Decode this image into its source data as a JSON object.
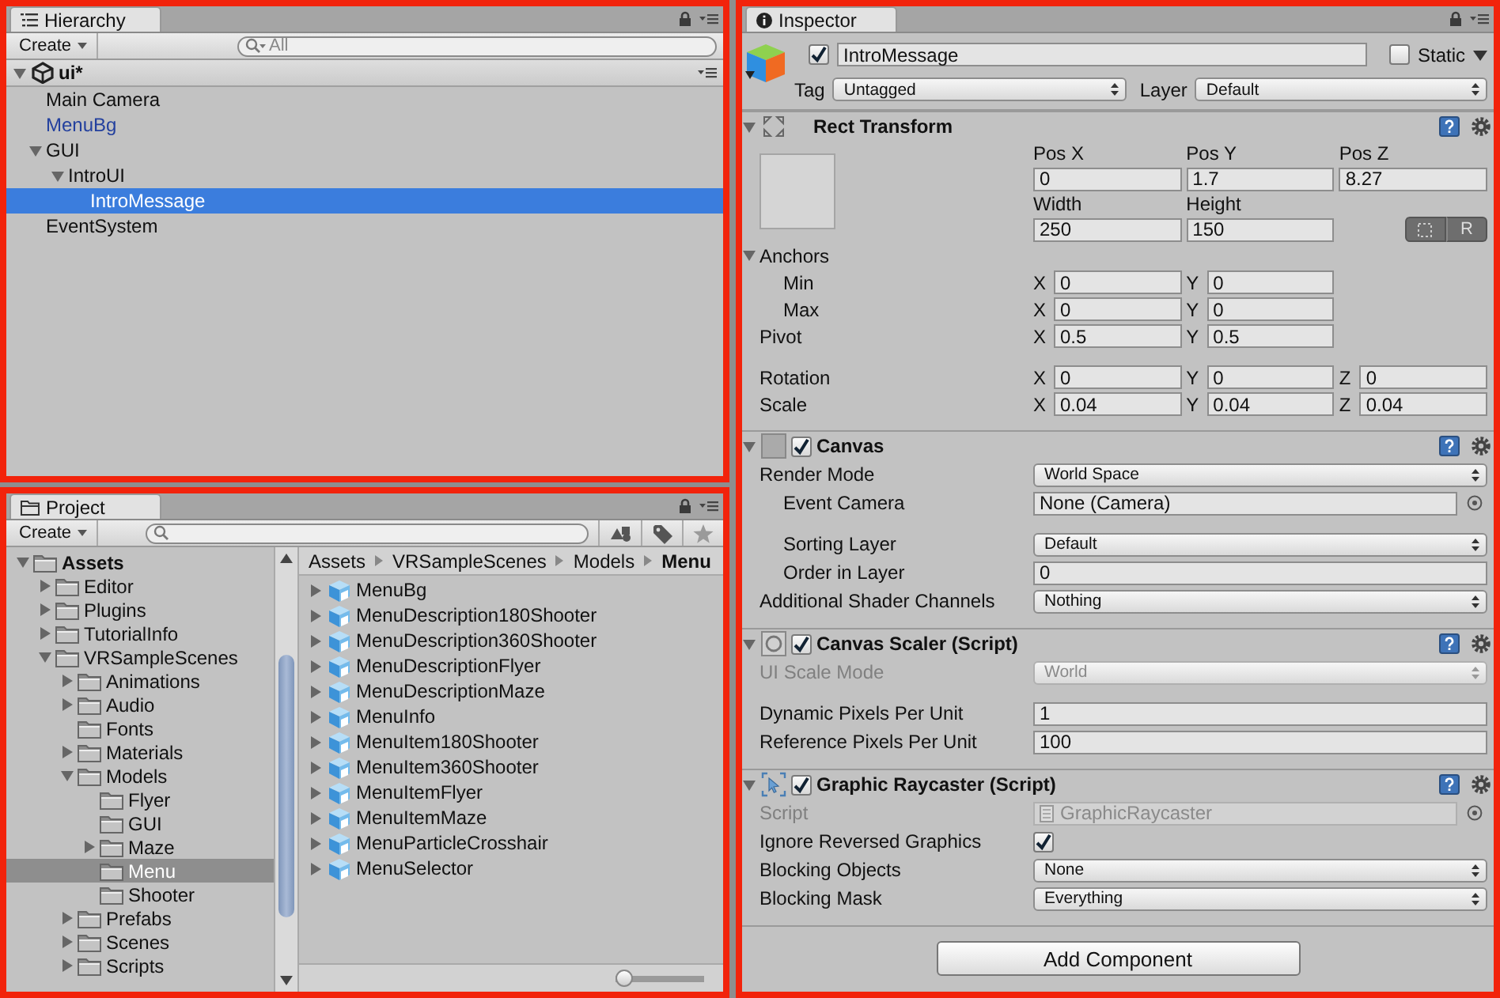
{
  "hierarchy": {
    "tab_title": "Hierarchy",
    "create_button": "Create",
    "search": {
      "placeholder": "All"
    },
    "scene": {
      "name": "ui*",
      "expanded": true
    },
    "items": [
      {
        "label": "Main Camera",
        "kind": "gameobject",
        "selected": false
      },
      {
        "label": "MenuBg",
        "kind": "prefab",
        "selected": false
      },
      {
        "label": "GUI",
        "kind": "gameobject",
        "selected": false,
        "expanded": true,
        "children": [
          {
            "label": "IntroUI",
            "kind": "gameobject",
            "selected": false,
            "expanded": true,
            "children": [
              {
                "label": "IntroMessage",
                "kind": "gameobject",
                "selected": true
              }
            ]
          }
        ]
      },
      {
        "label": "EventSystem",
        "kind": "gameobject",
        "selected": false
      }
    ]
  },
  "project": {
    "tab_title": "Project",
    "create_button": "Create",
    "folders": [
      {
        "label": "Assets",
        "selected": false,
        "expanded": true,
        "children": [
          {
            "label": "Editor",
            "selected": false,
            "expanded": false
          },
          {
            "label": "Plugins",
            "selected": false,
            "expanded": false
          },
          {
            "label": "TutorialInfo",
            "selected": false,
            "expanded": false
          },
          {
            "label": "VRSampleScenes",
            "selected": false,
            "expanded": true,
            "children": [
              {
                "label": "Animations",
                "selected": false,
                "expanded": false
              },
              {
                "label": "Audio",
                "selected": false,
                "expanded": false
              },
              {
                "label": "Fonts",
                "selected": false
              },
              {
                "label": "Materials",
                "selected": false,
                "expanded": false
              },
              {
                "label": "Models",
                "selected": false,
                "expanded": true,
                "children": [
                  {
                    "label": "Flyer",
                    "selected": false
                  },
                  {
                    "label": "GUI",
                    "selected": false
                  },
                  {
                    "label": "Maze",
                    "selected": false,
                    "expanded": false
                  },
                  {
                    "label": "Menu",
                    "selected": true
                  },
                  {
                    "label": "Shooter",
                    "selected": false
                  }
                ]
              },
              {
                "label": "Prefabs",
                "selected": false,
                "expanded": false
              },
              {
                "label": "Scenes",
                "selected": false,
                "expanded": false
              },
              {
                "label": "Scripts",
                "selected": false,
                "expanded": false
              }
            ]
          }
        ]
      }
    ],
    "breadcrumb": [
      {
        "label": "Assets",
        "selected": false
      },
      {
        "label": "VRSampleScenes",
        "selected": false
      },
      {
        "label": "Models",
        "selected": false
      },
      {
        "label": "Menu",
        "selected": true
      }
    ],
    "assets": [
      {
        "label": "MenuBg",
        "expanded": false
      },
      {
        "label": "MenuDescription180Shooter",
        "expanded": false
      },
      {
        "label": "MenuDescription360Shooter",
        "expanded": false
      },
      {
        "label": "MenuDescriptionFlyer",
        "expanded": false
      },
      {
        "label": "MenuDescriptionMaze",
        "expanded": false
      },
      {
        "label": "MenuInfo",
        "expanded": false
      },
      {
        "label": "MenuItem180Shooter",
        "expanded": false
      },
      {
        "label": "MenuItem360Shooter",
        "expanded": false
      },
      {
        "label": "MenuItemFlyer",
        "expanded": false
      },
      {
        "label": "MenuItemMaze",
        "expanded": false
      },
      {
        "label": "MenuParticleCrosshair",
        "expanded": false
      },
      {
        "label": "MenuSelector",
        "expanded": false
      }
    ],
    "zoom_slider": {
      "level": 0
    }
  },
  "inspector": {
    "tab_title": "Inspector",
    "object": {
      "active": true,
      "name": "IntroMessage",
      "static": false,
      "static_label": "Static",
      "tag_label": "Tag",
      "tag": "Untagged",
      "layer_label": "Layer",
      "layer": "Default"
    },
    "rect_transform": {
      "title": "Rect Transform",
      "expanded": true,
      "position": [
        {
          "label": "Pos X",
          "value": "0"
        },
        {
          "label": "Pos Y",
          "value": "1.7"
        },
        {
          "label": "Pos Z",
          "value": "8.27"
        }
      ],
      "size": [
        {
          "label": "Width",
          "value": "250"
        },
        {
          "label": "Height",
          "value": "150"
        }
      ],
      "raw_button": "R",
      "anchors": {
        "label": "Anchors",
        "expanded": true,
        "rows": [
          {
            "label": "Min",
            "fields": [
              {
                "axis": "X",
                "value": "0"
              },
              {
                "axis": "Y",
                "value": "0"
              }
            ]
          },
          {
            "label": "Max",
            "fields": [
              {
                "axis": "X",
                "value": "0"
              },
              {
                "axis": "Y",
                "value": "0"
              }
            ]
          }
        ]
      },
      "rows": [
        {
          "label": "Pivot",
          "fields": [
            {
              "axis": "X",
              "value": "0.5"
            },
            {
              "axis": "Y",
              "value": "0.5"
            }
          ]
        },
        {
          "label": "Rotation",
          "gap_before": true,
          "fields": [
            {
              "axis": "X",
              "value": "0"
            },
            {
              "axis": "Y",
              "value": "0"
            },
            {
              "axis": "Z",
              "value": "0"
            }
          ]
        },
        {
          "label": "Scale",
          "fields": [
            {
              "axis": "X",
              "value": "0.04"
            },
            {
              "axis": "Y",
              "value": "0.04"
            },
            {
              "axis": "Z",
              "value": "0.04"
            }
          ]
        }
      ]
    },
    "components": [
      {
        "title": "Canvas",
        "enabled": true,
        "expanded": true,
        "rows": [
          {
            "label": "Render Mode",
            "kind": "dropdown",
            "value": "World Space",
            "disabled": false,
            "children": [
              {
                "label": "Event Camera",
                "kind": "object",
                "value": "None (Camera)",
                "disabled": false
              },
              {
                "label": "Sorting Layer",
                "kind": "dropdown",
                "value": "Default",
                "disabled": false,
                "gap_before": true
              },
              {
                "label": "Order in Layer",
                "kind": "text",
                "value": "0",
                "disabled": false
              }
            ]
          },
          {
            "label": "Additional Shader Channels",
            "kind": "dropdown",
            "value": "Nothing",
            "disabled": false
          }
        ]
      },
      {
        "title": "Canvas Scaler (Script)",
        "enabled": true,
        "expanded": true,
        "rows": [
          {
            "label": "UI Scale Mode",
            "kind": "dropdown",
            "value": "World",
            "disabled": true
          },
          {
            "label": "Dynamic Pixels Per Unit",
            "kind": "text",
            "value": "1",
            "disabled": false,
            "gap_before": true
          },
          {
            "label": "Reference Pixels Per Unit",
            "kind": "text",
            "value": "100",
            "disabled": false
          }
        ]
      },
      {
        "title": "Graphic Raycaster (Script)",
        "enabled": true,
        "expanded": true,
        "rows": [
          {
            "label": "Script",
            "kind": "script",
            "value": "GraphicRaycaster",
            "disabled": true
          },
          {
            "label": "Ignore Reversed Graphics",
            "kind": "checkbox",
            "checked": true,
            "disabled": false
          },
          {
            "label": "Blocking Objects",
            "kind": "dropdown",
            "value": "None",
            "disabled": false
          },
          {
            "label": "Blocking Mask",
            "kind": "dropdown",
            "value": "Everything",
            "disabled": false
          }
        ]
      }
    ],
    "add_component_button": "Add Component"
  }
}
